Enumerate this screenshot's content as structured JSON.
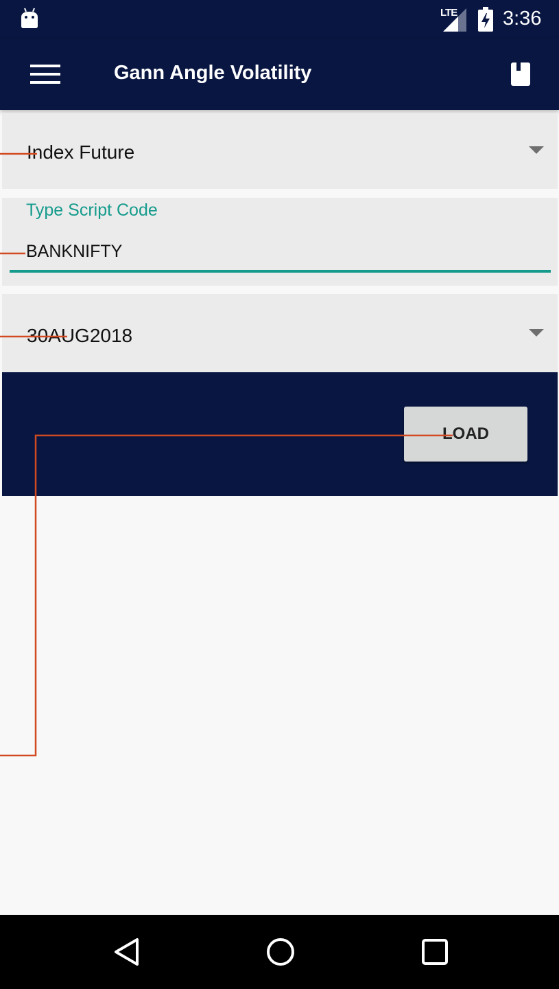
{
  "status_bar": {
    "network_type": "LTE",
    "time": "3:36",
    "icons": [
      "android-debug-icon",
      "signal-icon",
      "battery-charging-icon"
    ]
  },
  "app_bar": {
    "title": "Gann Angle Volatility",
    "menu_icon": "hamburger-menu-icon",
    "action_icon": "book-icon"
  },
  "form": {
    "instrument_type": {
      "selected": "Index Future"
    },
    "script_code": {
      "label": "Type Script Code",
      "value": "BANKNIFTY"
    },
    "expiry": {
      "selected": "30AUG2018"
    },
    "load_label": "LOAD"
  },
  "nav_bar": {
    "buttons": [
      "back-icon",
      "home-icon",
      "recents-icon"
    ]
  },
  "colors": {
    "primary": "#081641",
    "accent": "#159b8c",
    "field_background": "#ebebeb",
    "content_background": "#f8f8f8",
    "button_background": "#d6d7d7",
    "annotation_line": "#d24a22"
  }
}
